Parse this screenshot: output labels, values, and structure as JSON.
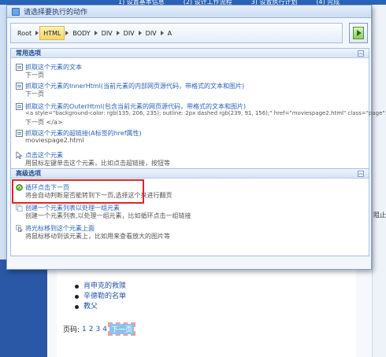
{
  "background": {
    "tabs": [
      "1) 设置基本信息",
      "(2) 设计工作流程",
      "3) 设置执行计划",
      "(4) 完成"
    ],
    "right_label": "阻止",
    "list_items": [
      "肖申克的救赎",
      "辛德勒的名单",
      "教父"
    ],
    "pager": {
      "label": "页码:",
      "pages": [
        "1",
        "2",
        "3",
        "4"
      ],
      "next": "下一页"
    }
  },
  "dialog": {
    "title": "请选择要执行的动作",
    "breadcrumb": [
      "Root",
      "HTML",
      "BODY",
      "DIV",
      "DIV",
      "DIV",
      "A"
    ],
    "run_button": "run-icon",
    "common": {
      "header": "常用选项",
      "items": [
        {
          "icon": "doc-icon",
          "title": "抓取这个元素的文本",
          "desc": [
            "下一页"
          ]
        },
        {
          "icon": "doc-icon",
          "title": "抓取这个元素的InnerHtml(当前元素的内部网页源代码，带格式的文本和图片)",
          "desc": [
            "下一页"
          ]
        },
        {
          "icon": "doc-icon",
          "title": "抓取这个元素的OuterHtml(包含当前元素的网页源代码，带格式的文本和图片)",
          "desc": [
            "<a style=\"background-color: rgb(135, 206, 235); outline: 2px dashed rgb(239, 91, 156);\" href=\"moviespage2.html\" class=\"page\">",
            "下一页 </a>"
          ]
        },
        {
          "icon": "doc-icon",
          "title": "抓取这个元素的超链接(A标签的href属性)",
          "desc": [
            "moviespage2.html"
          ]
        },
        {
          "icon": "cursor-icon",
          "title": "点击这个元素",
          "desc": [
            "用鼠标左键单击这个元素，比如点击超链接，按钮等"
          ]
        }
      ]
    },
    "advanced": {
      "header": "高级选项",
      "items": [
        {
          "icon": "loop-icon",
          "title": "循环点击下一页",
          "desc": [
            "将会自动判断是否能转到下一页,选择这个来进行翻页"
          ]
        },
        {
          "icon": "list-icon",
          "title": "创建一个元素列表以处理一组元素",
          "desc": [
            "创建一个元素列表,以处理一组元素，比如循环点击一组链接"
          ]
        },
        {
          "icon": "move-icon",
          "title": "将光标移到这个元素上面",
          "desc": [
            "将鼠标移动到该元素上，比如用来查看放大的图片等"
          ]
        }
      ]
    }
  },
  "colors": {
    "accent": "#2a62b6",
    "highlight_border": "#e1242a",
    "active_crumb": "#f5d56a"
  }
}
